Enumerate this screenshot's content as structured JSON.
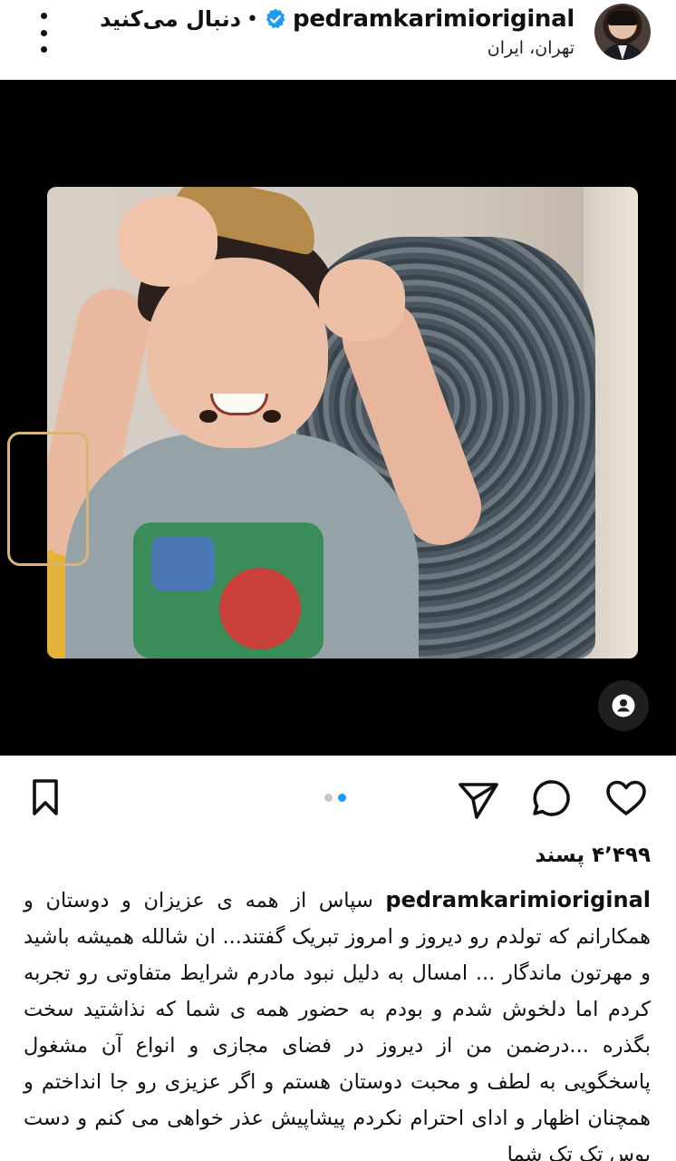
{
  "header": {
    "username": "pedramkarimioriginal",
    "follow_label": "دنبال می‌کنید",
    "separator": "•",
    "location": "تهران، ایران"
  },
  "icons": {
    "verified": "verified-badge-icon",
    "more": "more-options-icon",
    "user_tag": "user-tag-icon",
    "like": "heart-icon",
    "comment": "comment-icon",
    "share": "send-icon",
    "save": "bookmark-icon"
  },
  "colors": {
    "verified_blue": "#1d9bf0",
    "carousel_active": "#1d9bf0"
  },
  "carousel": {
    "count": 2,
    "active_index": 1
  },
  "likes_label": "۴٬۴۹۹ پسند",
  "caption": {
    "username": "pedramkarimioriginal",
    "text": "سپاس از همه ی عزیزان و دوستان و همکارانم که تولدم رو دیروز و امروز تبریک گفتند... ان شالله همیشه باشید و مهرتون ماندگار ... امسال به دلیل نبود مادرم شرایط متفاوتی رو تجربه کردم اما دلخوش شدم و بودم به حضور همه ی شما که نذاشتید سخت بگذره ...درضمن  من از دیروز در فضای مجازی و انواع آن مشغول پاسخگویی به لطف و محبت دوستان هستم و اگر عزیزی رو جا انداختم و همچنان اظهار و ادای احترام نکردم پیشاپیش عذر خواهی می کنم و دست بوس تک تک شما"
  }
}
